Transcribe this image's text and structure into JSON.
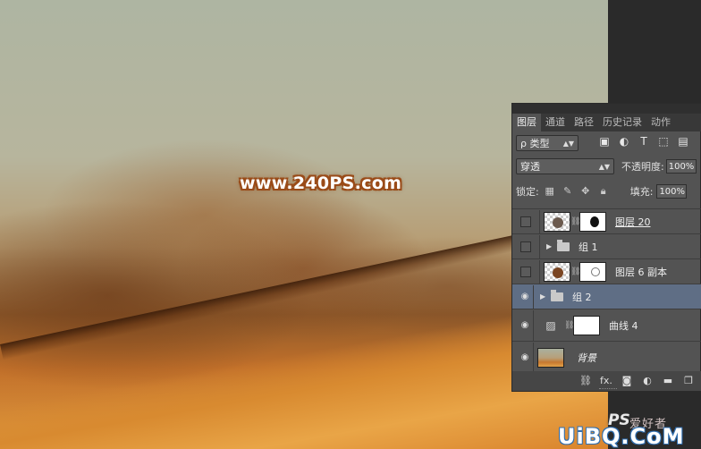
{
  "canvas": {
    "watermark": "www.240PS.com"
  },
  "layers_panel": {
    "tabs": [
      {
        "label": "图层",
        "active": true
      },
      {
        "label": "通道",
        "active": false
      },
      {
        "label": "路径",
        "active": false
      },
      {
        "label": "历史记录",
        "active": false
      },
      {
        "label": "动作",
        "active": false
      }
    ],
    "filter": {
      "label": "ρ 类型"
    },
    "filter_icons": [
      "image-icon",
      "adjustment-icon",
      "type-icon",
      "shape-icon",
      "smart-object-icon"
    ],
    "blend_mode": "穿透",
    "opacity_label": "不透明度:",
    "opacity_value": "100%",
    "lock_label": "锁定:",
    "fill_label": "填充:",
    "fill_value": "100%",
    "layers": [
      {
        "name": "图层 20",
        "visible": false,
        "type": "layer-with-mask",
        "selected": false
      },
      {
        "name": "组 1",
        "visible": false,
        "type": "group",
        "selected": false
      },
      {
        "name": "图层 6 副本",
        "visible": false,
        "type": "layer-with-mask",
        "selected": false
      },
      {
        "name": "组 2",
        "visible": true,
        "type": "group",
        "selected": true
      },
      {
        "name": "曲线 4",
        "visible": true,
        "type": "adjustment",
        "selected": false
      },
      {
        "name": "背景",
        "visible": true,
        "type": "background",
        "selected": false
      }
    ],
    "footer_icons": [
      "link-icon",
      "fx-icon",
      "mask-icon",
      "adjustment-icon",
      "folder-icon",
      "new-layer-icon"
    ],
    "fx_label": "fx."
  },
  "site_watermark": {
    "ps": "PS",
    "cn": "爱好者",
    "domain": "UiBQ.CoM"
  }
}
